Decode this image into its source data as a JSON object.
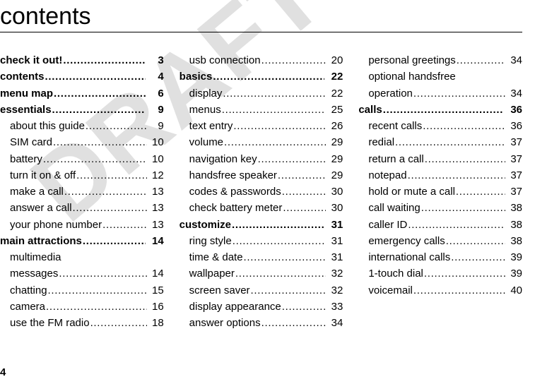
{
  "watermark": "DRAFT",
  "title": "contents",
  "page_number": "4",
  "col1": {
    "s1": {
      "label": "check it out!",
      "page": "3"
    },
    "s2": {
      "label": "contents",
      "page": "4"
    },
    "s3": {
      "label": "menu map",
      "page": "6"
    },
    "s4": {
      "label": "essentials",
      "page": "9",
      "i1": {
        "label": "about this guide",
        "page": "9"
      },
      "i2": {
        "label": "SIM card",
        "page": "10"
      },
      "i3": {
        "label": "battery",
        "page": "10"
      },
      "i4": {
        "label": "turn it on & off",
        "page": "12"
      },
      "i5": {
        "label": "make a call",
        "page": "13"
      },
      "i6": {
        "label": "answer a call",
        "page": "13"
      },
      "i7": {
        "label": "your phone number",
        "page": "13"
      }
    },
    "s5": {
      "label": "main attractions",
      "page": "14",
      "i1a": "multimedia",
      "i1b": {
        "label": "messages",
        "page": "14"
      },
      "i2": {
        "label": "chatting",
        "page": "15"
      },
      "i3": {
        "label": "camera",
        "page": "16"
      },
      "i4": {
        "label": "use the FM radio",
        "page": "18"
      }
    }
  },
  "col2": {
    "carry": {
      "i1": {
        "label": "usb connection",
        "page": "20"
      }
    },
    "s1": {
      "label": "basics",
      "page": "22",
      "i1": {
        "label": "display",
        "page": "22"
      },
      "i2": {
        "label": "menus",
        "page": "25"
      },
      "i3": {
        "label": "text entry",
        "page": "26"
      },
      "i4": {
        "label": "volume",
        "page": "29"
      },
      "i5": {
        "label": "navigation key",
        "page": "29"
      },
      "i6": {
        "label": "handsfree speaker",
        "page": "29"
      },
      "i7": {
        "label": "codes & passwords",
        "page": "30"
      },
      "i8": {
        "label": "check battery meter",
        "page": "30"
      }
    },
    "s2": {
      "label": "customize",
      "page": "31",
      "i1": {
        "label": "ring style",
        "page": "31"
      },
      "i2": {
        "label": "time & date",
        "page": "31"
      },
      "i3": {
        "label": "wallpaper",
        "page": "32"
      },
      "i4": {
        "label": "screen saver",
        "page": "32"
      },
      "i5": {
        "label": "display appearance",
        "page": "33"
      },
      "i6": {
        "label": "answer options",
        "page": "34"
      }
    }
  },
  "col3": {
    "carry": {
      "i1": {
        "label": "personal greetings",
        "page": "34"
      },
      "i2a": "optional handsfree",
      "i2b": {
        "label": "operation",
        "page": "34"
      }
    },
    "s1": {
      "label": "calls",
      "page": "36",
      "i1": {
        "label": "recent calls",
        "page": "36"
      },
      "i2": {
        "label": "redial",
        "page": "37"
      },
      "i3": {
        "label": "return a call",
        "page": "37"
      },
      "i4": {
        "label": "notepad",
        "page": "37"
      },
      "i5": {
        "label": "hold or mute a call",
        "page": "37"
      },
      "i6": {
        "label": "call waiting",
        "page": "38"
      },
      "i7": {
        "label": "caller ID",
        "page": "38"
      },
      "i8": {
        "label": "emergency calls",
        "page": "38"
      },
      "i9": {
        "label": "international calls",
        "page": "39"
      },
      "i10": {
        "label": "1-touch dial",
        "page": "39"
      },
      "i11": {
        "label": "voicemail",
        "page": "40"
      }
    }
  }
}
